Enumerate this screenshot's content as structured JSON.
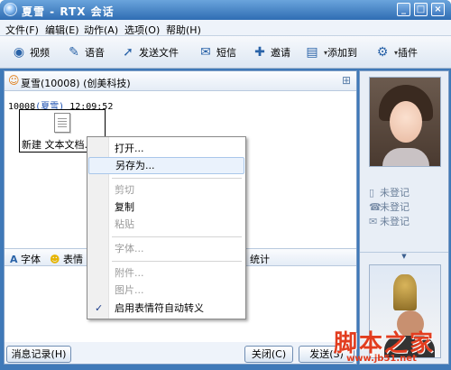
{
  "window": {
    "title": "夏雪 - RTX 会话",
    "min": "_",
    "max": "□",
    "close": "×"
  },
  "menu": [
    "文件(F)",
    "编辑(E)",
    "动作(A)",
    "选项(O)",
    "帮助(H)"
  ],
  "toolbar": {
    "video": "视频",
    "voice": "语音",
    "send_file": "发送文件",
    "sms": "短信",
    "invite": "邀请",
    "add_to": "添加到",
    "plugin": "插件"
  },
  "contact": {
    "name": "夏雪(10008) (创美科技)"
  },
  "message": {
    "sender_id": "10008",
    "sender_name": "(夏雪)",
    "time": "12:09:52",
    "file_name": "新建 文本文档.t"
  },
  "format_bar": {
    "font": "字体",
    "emoticon": "表情",
    "stats": "统计"
  },
  "buttons": {
    "history": "消息记录(H)",
    "close": "关闭(C)",
    "send": "发送(S)"
  },
  "side": {
    "unregistered_1": "未登记",
    "unregistered_2": "未登记",
    "unregistered_3": "未登记"
  },
  "context_menu": {
    "open": "打开...",
    "save_as": "另存为...",
    "cut": "剪切",
    "copy": "复制",
    "paste": "粘贴",
    "font": "字体...",
    "attachment": "附件...",
    "image": "图片...",
    "auto_emoticon": "启用表情符自动转义",
    "check": "✓"
  },
  "watermark": {
    "text": "脚本之家",
    "url": "www.jb51.net"
  },
  "colors": {
    "titlebar": "#2f6db3",
    "highlight": "#eaf2fc",
    "watermark": "#e23d1f"
  }
}
